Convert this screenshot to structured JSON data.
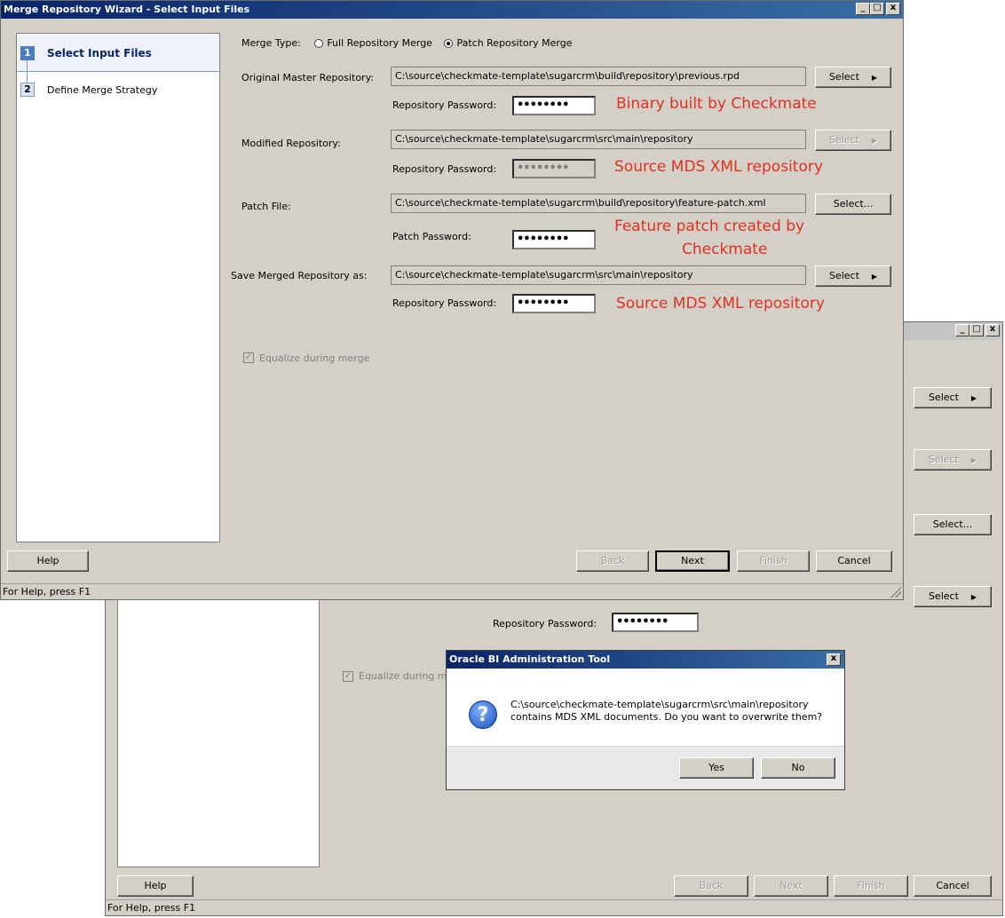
{
  "back_window": {
    "title_buttons": {
      "min": "_",
      "max": "□",
      "close": "x"
    },
    "select_buttons": [
      "Select",
      "Select",
      "Select...",
      "Select"
    ],
    "password_label": "Repository Password:",
    "password_value": "••••••••",
    "equalize_label": "Equalize during me",
    "check_mark": "✓",
    "buttons": {
      "help": "Help",
      "back": "Back",
      "next": "Next",
      "finish": "Finish",
      "cancel": "Cancel"
    },
    "status": "For Help, press F1"
  },
  "dialog": {
    "title": "Oracle BI Administration Tool",
    "close": "x",
    "icon": "?",
    "message_line1": "C:\\source\\checkmate-template\\sugarcrm\\src\\main\\repository",
    "message_line2": "contains MDS XML documents. Do you want to overwrite them?",
    "yes": "Yes",
    "no": "No"
  },
  "front_window": {
    "title": "Merge Repository Wizard - Select Input Files",
    "title_buttons": {
      "min": "_",
      "max": "□",
      "close": "x"
    },
    "steps": [
      {
        "num": "1",
        "label": "Select Input Files"
      },
      {
        "num": "2",
        "label": "Define Merge Strategy"
      }
    ],
    "merge_type": {
      "label": "Merge Type:",
      "option_full": "Full Repository Merge",
      "option_patch": "Patch Repository Merge",
      "selected": "Patch Repository Merge"
    },
    "original": {
      "label": "Original Master Repository:",
      "path": "C:\\source\\checkmate-template\\sugarcrm\\build\\repository\\previous.rpd",
      "select": "Select",
      "pw_label": "Repository Password:",
      "pw_value": "••••••••"
    },
    "modified": {
      "label": "Modified Repository:",
      "path": "C:\\source\\checkmate-template\\sugarcrm\\src\\main\\repository",
      "select": "Select",
      "pw_label": "Repository Password:",
      "pw_value": "••••••••"
    },
    "patch": {
      "label": "Patch File:",
      "path": "C:\\source\\checkmate-template\\sugarcrm\\build\\repository\\feature-patch.xml",
      "select": "Select...",
      "pw_label": "Patch Password:",
      "pw_value": "••••••••"
    },
    "save": {
      "label": "Save Merged Repository as:",
      "path": "C:\\source\\checkmate-template\\sugarcrm\\src\\main\\repository",
      "select": "Select",
      "pw_label": "Repository Password:",
      "pw_value": "••••••••"
    },
    "equalize_label": "Equalize during merge",
    "check_mark": "✓",
    "arrow": "▶",
    "buttons": {
      "help": "Help",
      "back": "Back",
      "next": "Next",
      "finish": "Finish",
      "cancel": "Cancel"
    },
    "status": "For Help, press F1"
  },
  "annotations": {
    "original": "Binary built by Checkmate",
    "modified": "Source MDS XML repository",
    "patch_line1": "Feature patch created by",
    "patch_line2": "Checkmate",
    "save": "Source MDS XML repository"
  }
}
